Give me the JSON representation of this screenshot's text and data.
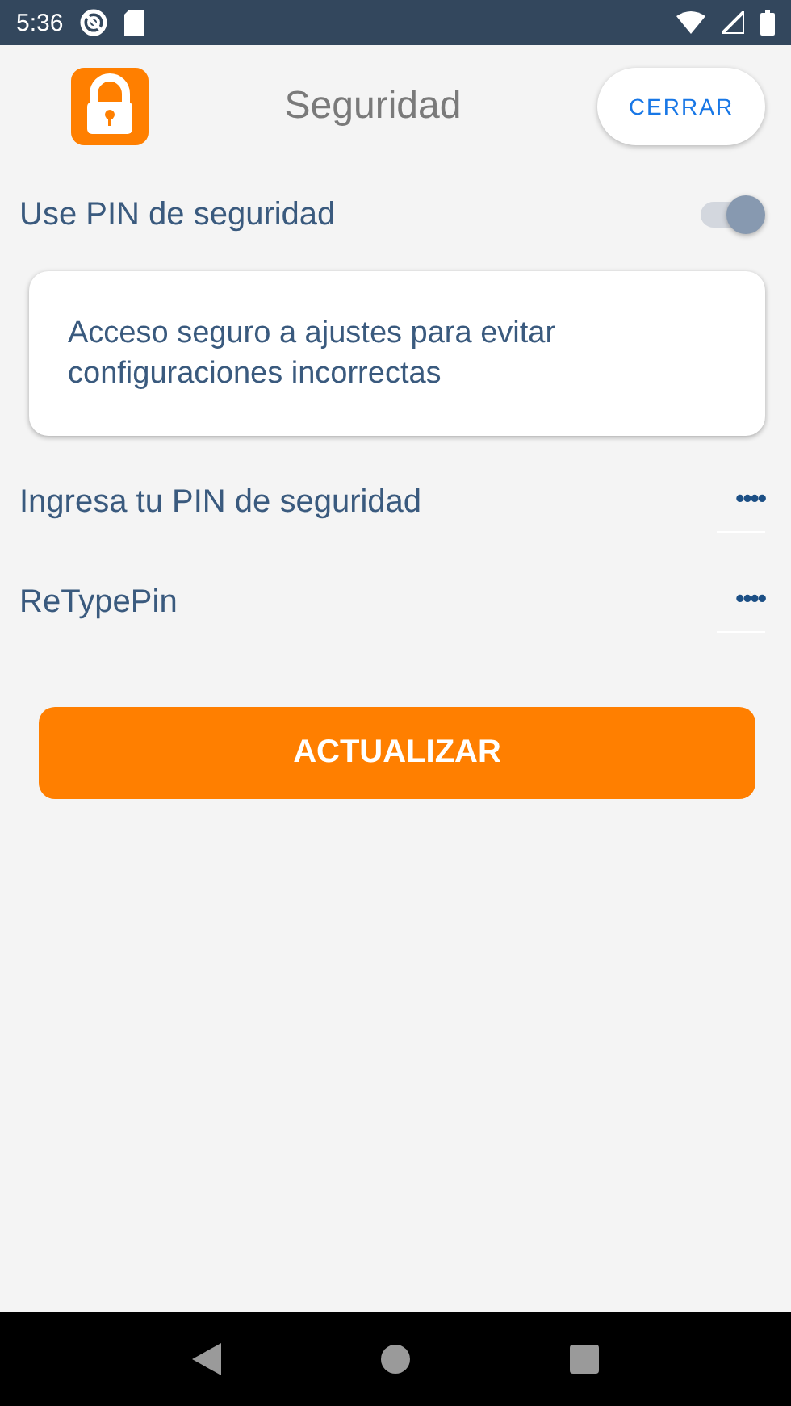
{
  "status_bar": {
    "time": "5:36"
  },
  "header": {
    "title": "Seguridad",
    "close_button": "CERRAR"
  },
  "pin_toggle": {
    "label": "Use PIN de seguridad",
    "on": true
  },
  "info_card": {
    "text": "Acceso seguro a ajustes para evitar configuraciones incorrectas"
  },
  "fields": [
    {
      "label": "Ingresa tu PIN de seguridad",
      "value": "••••"
    },
    {
      "label": "ReTypePin",
      "value": "••••"
    }
  ],
  "update_button": "ACTUALIZAR"
}
